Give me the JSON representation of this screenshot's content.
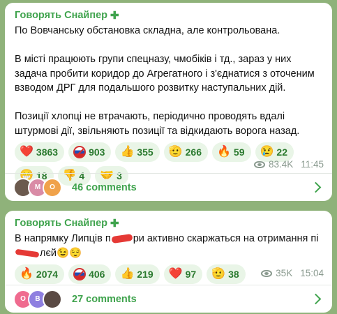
{
  "post1": {
    "channel": "Говорять Снайпер",
    "channel_icon": "plus-icon",
    "paragraphs": [
      "По Вовчанську обстановка складна, але контрольована.",
      "В місті працюють групи спецназу, чмобіків і тд., зараз у них задача пробити коридор до Агрегатного і з'єднатися з оточеним взводом ДРГ для подальшого розвитку наступальних дій.",
      "Позиції хлопці не втрачають, періодично проводять вдалі штурмові дії, звільняють позиції та відкидають ворога назад."
    ],
    "reactions": [
      {
        "emoji": "❤️",
        "count": "3863"
      },
      {
        "emoji": "flag-no-icon",
        "count": "903"
      },
      {
        "emoji": "👍",
        "count": "355"
      },
      {
        "emoji": "🫡",
        "count": "266"
      },
      {
        "emoji": "🔥",
        "count": "59"
      },
      {
        "emoji": "😢",
        "count": "22"
      },
      {
        "emoji": "😁",
        "count": "18"
      },
      {
        "emoji": "👎",
        "count": "4"
      },
      {
        "emoji": "🤝",
        "count": "3"
      }
    ],
    "views": "83.4K",
    "time": "11:45",
    "comments": "46 comments",
    "avatars": [
      "",
      "M",
      "O"
    ]
  },
  "post2": {
    "channel": "Говорять Снайпер",
    "channel_icon": "plus-icon",
    "text_parts": [
      "В напрямку Липців п",
      "ри активно скаржаться на отримання пі",
      "лєй😉😌"
    ],
    "reactions": [
      {
        "emoji": "🔥",
        "count": "2074"
      },
      {
        "emoji": "flag-no-icon",
        "count": "406"
      },
      {
        "emoji": "👍",
        "count": "219"
      },
      {
        "emoji": "❤️",
        "count": "97"
      },
      {
        "emoji": "🫡",
        "count": "38"
      }
    ],
    "views": "35K",
    "time": "15:04",
    "comments": "27 comments",
    "avatars": [
      "O",
      "B",
      ""
    ]
  },
  "colors": {
    "accent": "#3fa34d",
    "background": "#8fb27a",
    "reaction_bg": "#e9f5e7"
  }
}
